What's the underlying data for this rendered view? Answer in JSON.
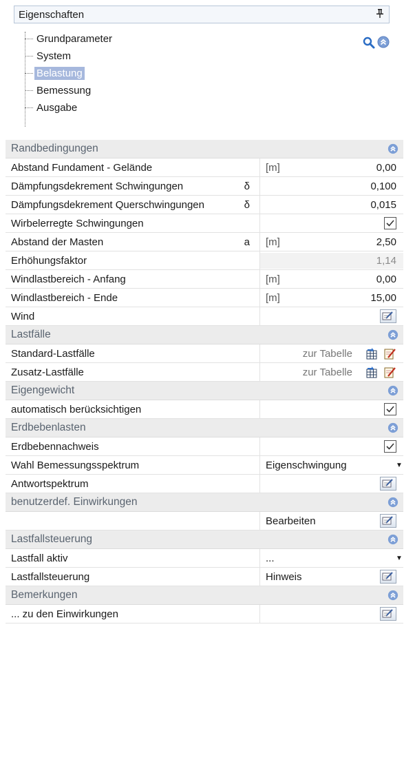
{
  "header": {
    "title": "Eigenschaften",
    "pin_glyph": "ф"
  },
  "tree": {
    "items": [
      {
        "label": "Grundparameter",
        "selected": false
      },
      {
        "label": "System",
        "selected": false
      },
      {
        "label": "Belastung",
        "selected": true
      },
      {
        "label": "Bemessung",
        "selected": false
      },
      {
        "label": "Ausgabe",
        "selected": false
      }
    ]
  },
  "icons": {
    "search": "search-icon",
    "collapse": "collapse-icon",
    "edit": "edit-icon",
    "table": "table-icon",
    "check": "checkmark-icon"
  },
  "sections": {
    "randbedingungen": {
      "title": "Randbedingungen",
      "rows": [
        {
          "label": "Abstand Fundament - Gelände",
          "symbol": "",
          "unit": "[m]",
          "value": "0,00"
        },
        {
          "label": "Dämpfungsdekrement Schwingungen",
          "symbol": "δ",
          "unit": "",
          "value": "0,100"
        },
        {
          "label": "Dämpfungsdekrement Querschwingungen",
          "symbol": "δ",
          "unit": "",
          "value": "0,015"
        },
        {
          "label": "Wirbelerregte Schwingungen",
          "symbol": "",
          "unit": "",
          "checked": true
        },
        {
          "label": "Abstand der Masten",
          "symbol": "a",
          "unit": "[m]",
          "value": "2,50"
        },
        {
          "label": "Erhöhungsfaktor",
          "symbol": "",
          "unit": "",
          "value": "1,14"
        },
        {
          "label": "Windlastbereich - Anfang",
          "symbol": "",
          "unit": "[m]",
          "value": "0,00"
        },
        {
          "label": "Windlastbereich - Ende",
          "symbol": "",
          "unit": "[m]",
          "value": "15,00"
        },
        {
          "label": "Wind",
          "symbol": "",
          "unit": ""
        }
      ]
    },
    "lastfaelle": {
      "title": "Lastfälle",
      "rows": [
        {
          "label": "Standard-Lastfälle",
          "link": "zur Tabelle"
        },
        {
          "label": "Zusatz-Lastfälle",
          "link": "zur Tabelle"
        }
      ]
    },
    "eigengewicht": {
      "title": "Eigengewicht",
      "rows": [
        {
          "label": "automatisch berücksichtigen",
          "checked": true
        }
      ]
    },
    "erdbebenlasten": {
      "title": "Erdbebenlasten",
      "rows": [
        {
          "label": "Erdbebennachweis",
          "checked": true
        },
        {
          "label": "Wahl Bemessungsspektrum",
          "dropdown": "Eigenschwingung"
        },
        {
          "label": "Antwortspektrum"
        }
      ]
    },
    "einwirkungen": {
      "title": "benutzerdef. Einwirkungen",
      "rows": [
        {
          "label": "",
          "button_text": "Bearbeiten"
        }
      ]
    },
    "lastfallsteuerung": {
      "title": "Lastfallsteuerung",
      "rows": [
        {
          "label": "Lastfall aktiv",
          "dropdown": "..."
        },
        {
          "label": "Lastfallsteuerung",
          "button_text": "Hinweis"
        }
      ]
    },
    "bemerkungen": {
      "title": "Bemerkungen",
      "rows": [
        {
          "label": "... zu den Einwirkungen"
        }
      ]
    }
  }
}
